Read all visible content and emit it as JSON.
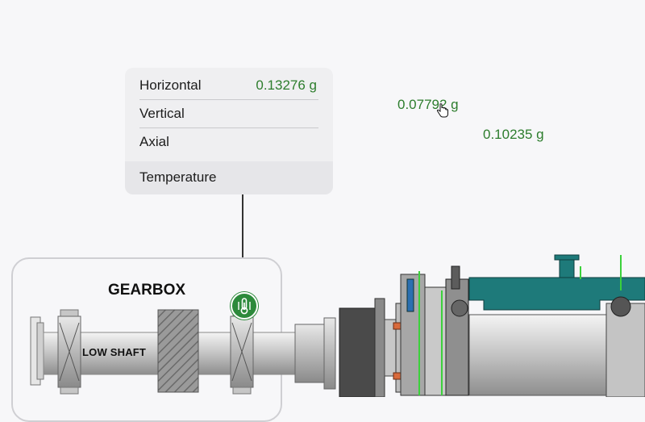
{
  "tooltip": {
    "rows": [
      {
        "label": "Horizontal",
        "value": "0.13276 g"
      },
      {
        "label": "Vertical",
        "value": ""
      },
      {
        "label": "Axial",
        "value": ""
      }
    ],
    "temperature_label": "Temperature"
  },
  "readouts": {
    "vertical_value": "0.07792 g",
    "axial_value": "0.10235 g"
  },
  "gearbox": {
    "title": "GEARBOX",
    "shaft_label": "LOW SHAFT"
  },
  "icons": {
    "sensor": "thermometer-sensor-icon",
    "cursor": "hand-pointer-icon"
  },
  "colors": {
    "value_green": "#2d7d2d",
    "sensor_green": "#2c8a3b",
    "housing_teal": "#1e7a7a"
  }
}
